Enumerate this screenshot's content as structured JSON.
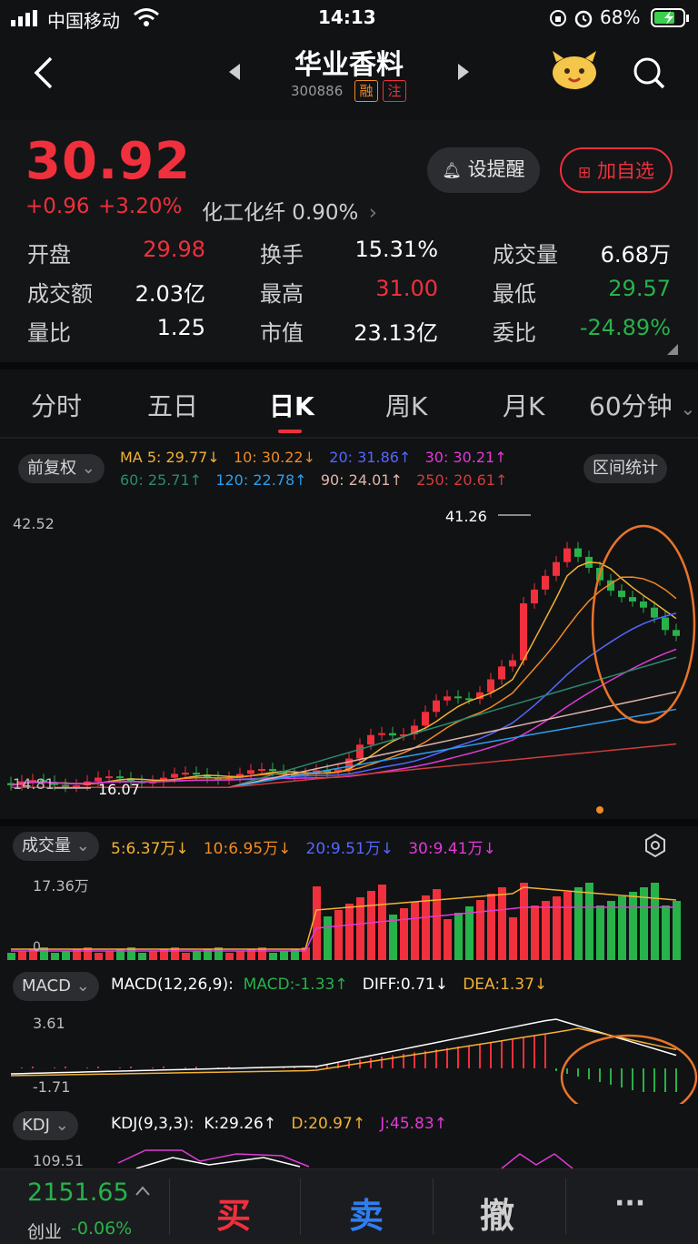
{
  "status_bar": {
    "carrier": "中国移动",
    "time": "14:13",
    "battery": "68%"
  },
  "header": {
    "title": "华业香料",
    "code": "300886",
    "tags": [
      "融",
      "注"
    ]
  },
  "quote": {
    "price": "30.92",
    "change": "+0.96",
    "change_pct": "+3.20%",
    "sector": "化工化纤 0.90%",
    "sector_arrow": "›",
    "remind_label": "设提醒",
    "add_watch_label": "加自选"
  },
  "stats": [
    {
      "label": "开盘",
      "value": "29.98",
      "tone": "red"
    },
    {
      "label": "换手",
      "value": "15.31%",
      "tone": "white"
    },
    {
      "label": "成交量",
      "value": "6.68万",
      "tone": "white"
    },
    {
      "label": "成交额",
      "value": "2.03亿",
      "tone": "white"
    },
    {
      "label": "最高",
      "value": "31.00",
      "tone": "red"
    },
    {
      "label": "最低",
      "value": "29.57",
      "tone": "green"
    },
    {
      "label": "量比",
      "value": "1.25",
      "tone": "white"
    },
    {
      "label": "市值",
      "value": "23.13亿",
      "tone": "white"
    },
    {
      "label": "委比",
      "value": "-24.89%",
      "tone": "green"
    }
  ],
  "tabs": [
    "分时",
    "五日",
    "日K",
    "周K",
    "月K",
    "60分钟"
  ],
  "tab_dropdown": "⌄",
  "kline": {
    "adjust_label": "前复权",
    "range_stat_label": "区间统计",
    "ma_row1": [
      {
        "text": "MA 5: 29.77↓",
        "color": "#f2b233"
      },
      {
        "text": "10: 30.22↓",
        "color": "#f08a24"
      },
      {
        "text": "20: 31.86↑",
        "color": "#5566ff"
      },
      {
        "text": "30: 30.21↑",
        "color": "#e03ad6"
      }
    ],
    "ma_row2": [
      {
        "text": "60: 25.71↑",
        "color": "#2a8a6e"
      },
      {
        "text": "120: 22.78↑",
        "color": "#2a9ef0"
      },
      {
        "text": "90: 24.01↑",
        "color": "#e0b4a8"
      },
      {
        "text": "250: 20.61↑",
        "color": "#d23c3c"
      }
    ],
    "axis_high": "42.52",
    "axis_low": "14.81",
    "peak_label": "41.26",
    "trough_label": "16.07"
  },
  "volume": {
    "label": "成交量",
    "items": [
      {
        "text": "5:6.37万↓",
        "color": "#f2b233"
      },
      {
        "text": "10:6.95万↓",
        "color": "#f08a24"
      },
      {
        "text": "20:9.51万↓",
        "color": "#5566ff"
      },
      {
        "text": "30:9.41万↓",
        "color": "#e03ad6"
      }
    ],
    "axis_high": "17.36万",
    "axis_low": "0"
  },
  "macd": {
    "label": "MACD",
    "items": [
      {
        "text": "MACD(12,26,9):",
        "color": "#ffffff"
      },
      {
        "text": "MACD:-1.33↑",
        "color": "#27b24a"
      },
      {
        "text": "DIFF:0.71↓",
        "color": "#ffffff"
      },
      {
        "text": "DEA:1.37↓",
        "color": "#f2b233"
      }
    ],
    "axis_high": "3.61",
    "axis_low": "-1.71"
  },
  "kdj": {
    "label": "KDJ",
    "items": [
      {
        "text": "KDJ(9,3,3):",
        "color": "#ffffff"
      },
      {
        "text": "K:29.26↑",
        "color": "#ffffff"
      },
      {
        "text": "D:20.97↑",
        "color": "#f2b233"
      },
      {
        "text": "J:45.83↑",
        "color": "#e03ad6"
      }
    ],
    "axis_high": "109.51"
  },
  "bottom": {
    "index_value": "2151.65",
    "index_name": "创业",
    "index_change": "-0.06%",
    "buy": "买",
    "sell": "卖",
    "cancel": "撤",
    "more": "···"
  }
}
